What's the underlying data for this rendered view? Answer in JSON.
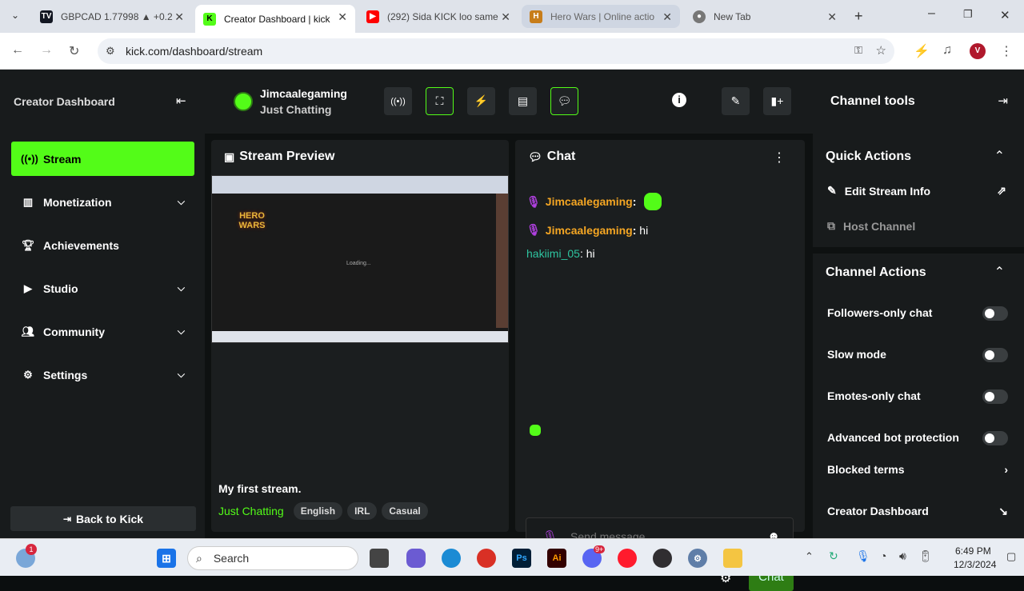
{
  "browser": {
    "tabs": [
      {
        "title": "GBPCAD 1.77998 ▲ +0.2"
      },
      {
        "title": "Creator Dashboard | kick"
      },
      {
        "title": "(292) Sida KICK loo same"
      },
      {
        "title": "Hero Wars | Online actio"
      },
      {
        "title": "New Tab"
      }
    ],
    "url": "kick.com/dashboard/stream"
  },
  "sidebar": {
    "title": "Creator Dashboard",
    "items": [
      {
        "label": "Stream"
      },
      {
        "label": "Monetization"
      },
      {
        "label": "Achievements"
      },
      {
        "label": "Studio"
      },
      {
        "label": "Community"
      },
      {
        "label": "Settings"
      }
    ],
    "back_label": "Back to Kick"
  },
  "header": {
    "username": "Jimcaalegaming",
    "category": "Just Chatting"
  },
  "preview": {
    "title": "Stream Preview",
    "loading_text": "Loading...",
    "game_logo": "HERO WARS",
    "stream_title": "My first stream.",
    "category": "Just Chatting",
    "tags": [
      "English",
      "IRL",
      "Casual"
    ]
  },
  "chat": {
    "title": "Chat",
    "messages": [
      {
        "user": "Jimcaalegaming",
        "text": ""
      },
      {
        "user": "Jimcaalegaming",
        "text": " hi"
      },
      {
        "user": "hakiimi_05",
        "text": " hi"
      }
    ],
    "placeholder": "Send message...",
    "send_label": "Chat"
  },
  "channel_tools": {
    "title": "Channel tools",
    "quick_actions_title": "Quick Actions",
    "edit_stream_info": "Edit Stream Info",
    "host_channel": "Host Channel",
    "channel_actions_title": "Channel Actions",
    "actions": [
      {
        "label": "Followers-only chat"
      },
      {
        "label": "Slow mode"
      },
      {
        "label": "Emotes-only chat"
      },
      {
        "label": "Advanced bot protection"
      }
    ],
    "blocked_terms": "Blocked terms",
    "creator_dashboard": "Creator Dashboard"
  },
  "taskbar": {
    "search_label": "Search",
    "time": "6:49 PM",
    "date": "12/3/2024",
    "weather_badge": "1",
    "discord_badge": "9+"
  },
  "colors": {
    "accent": "#53fc18",
    "username": "#f5a623",
    "user2": "#2ec4a0"
  }
}
